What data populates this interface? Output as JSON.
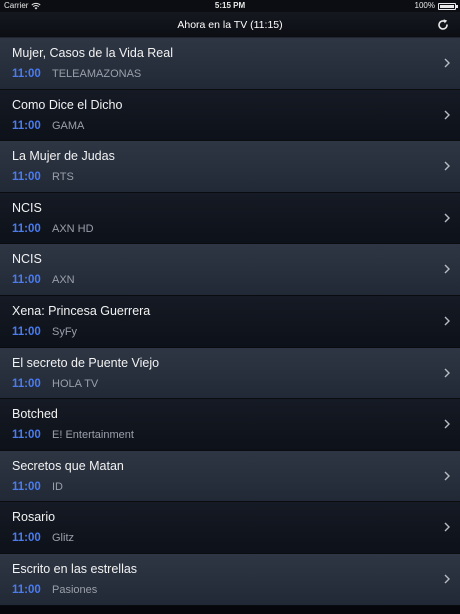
{
  "status_bar": {
    "carrier": "Carrier",
    "time": "5:15 PM",
    "battery": "100%"
  },
  "nav": {
    "title": "Ahora en la TV (11:15)",
    "refresh_icon": "refresh-icon"
  },
  "programs": [
    {
      "title": "Mujer, Casos de la Vida Real",
      "time": "11:00",
      "channel": "TELEAMAZONAS"
    },
    {
      "title": "Como Dice el Dicho",
      "time": "11:00",
      "channel": "GAMA"
    },
    {
      "title": "La Mujer de Judas",
      "time": "11:00",
      "channel": "RTS"
    },
    {
      "title": "NCIS",
      "time": "11:00",
      "channel": "AXN HD"
    },
    {
      "title": "NCIS",
      "time": "11:00",
      "channel": "AXN"
    },
    {
      "title": "Xena: Princesa Guerrera",
      "time": "11:00",
      "channel": "SyFy"
    },
    {
      "title": "El secreto de Puente Viejo",
      "time": "11:00",
      "channel": "HOLA TV"
    },
    {
      "title": "Botched",
      "time": "11:00",
      "channel": "E! Entertainment"
    },
    {
      "title": "Secretos que Matan",
      "time": "11:00",
      "channel": "ID"
    },
    {
      "title": "Rosario",
      "time": "11:00",
      "channel": "Glitz"
    },
    {
      "title": "Escrito en las estrellas",
      "time": "11:00",
      "channel": "Pasiones"
    }
  ],
  "colors": {
    "time_accent": "#4a7cf0",
    "row_light": "#2e3644",
    "row_dark": "#151a24"
  }
}
